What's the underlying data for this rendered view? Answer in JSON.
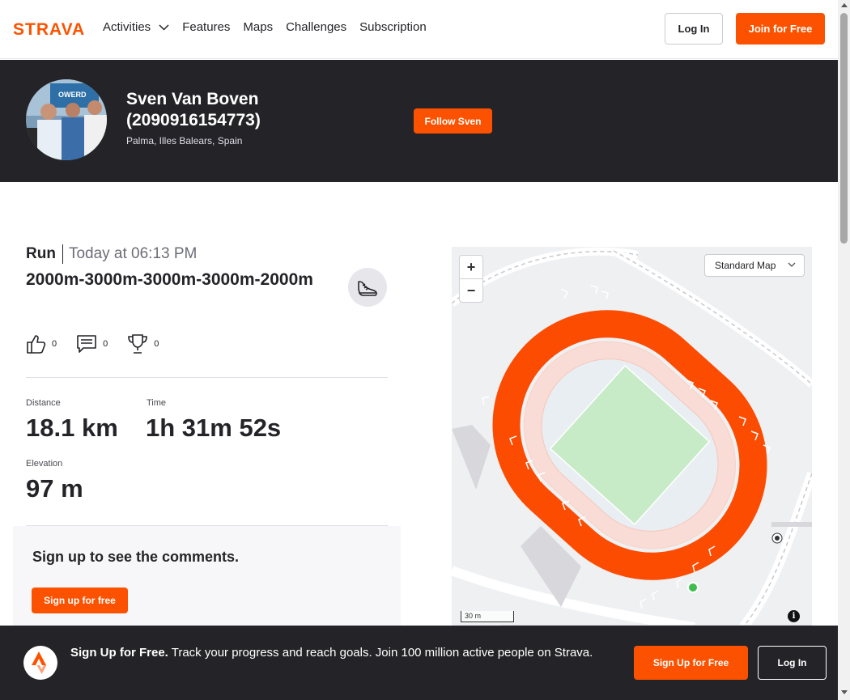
{
  "nav": {
    "logo": "STRAVA",
    "links": [
      "Activities",
      "Features",
      "Maps",
      "Challenges",
      "Subscription"
    ],
    "login": "Log In",
    "join": "Join for Free"
  },
  "athlete": {
    "name": "Sven Van Boven (2090916154773)",
    "location": "Palma, Illes Balears, Spain",
    "follow": "Follow Sven"
  },
  "activity": {
    "type": "Run",
    "date": "Today at 06:13 PM",
    "title": "2000m-3000m-3000m-3000m-2000m",
    "kudos": "0",
    "comments": "0",
    "achievements": "0",
    "stats": {
      "distance_label": "Distance",
      "distance_value": "18.1 km",
      "time_label": "Time",
      "time_value": "1h 31m 52s",
      "elevation_label": "Elevation",
      "elevation_value": "97 m"
    }
  },
  "comments": {
    "heading": "Sign up to see the comments.",
    "button": "Sign up for free"
  },
  "map": {
    "style_select": "Standard Map",
    "zoom_in": "+",
    "zoom_out": "−",
    "scale": "30 m",
    "info": "i"
  },
  "banner": {
    "bold": "Sign Up for Free.",
    "text": " Track your progress and reach goals. Join 100 million active people on Strava.",
    "signup": "Sign Up for Free",
    "login": "Log In"
  },
  "colors": {
    "brand": "#fc5200",
    "dark": "#242428",
    "route": "#fc4c02"
  }
}
